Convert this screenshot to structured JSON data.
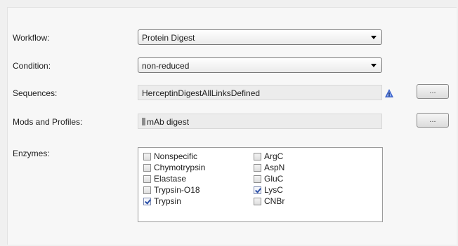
{
  "labels": {
    "workflow": "Workflow:",
    "condition": "Condition:",
    "sequences": "Sequences:",
    "mods": "Mods and Profiles:",
    "enzymes": "Enzymes:"
  },
  "workflow": {
    "selected": "Protein Digest"
  },
  "condition": {
    "selected": "non-reduced"
  },
  "sequences": {
    "value": "HerceptinDigestAllLinksDefined",
    "browse_label": "..."
  },
  "mods": {
    "value": "mAb digest",
    "browse_label": "..."
  },
  "enzymes": {
    "col1": [
      {
        "label": "Nonspecific",
        "checked": false
      },
      {
        "label": "Chymotrypsin",
        "checked": false
      },
      {
        "label": "Elastase",
        "checked": false
      },
      {
        "label": "Trypsin-O18",
        "checked": false
      },
      {
        "label": "Trypsin",
        "checked": true
      }
    ],
    "col2": [
      {
        "label": "ArgC",
        "checked": false
      },
      {
        "label": "AspN",
        "checked": false
      },
      {
        "label": "GluC",
        "checked": false
      },
      {
        "label": "LysC",
        "checked": true
      },
      {
        "label": "CNBr",
        "checked": false
      }
    ]
  },
  "colors": {
    "accent": "#2a4fa8",
    "alert_icon": "#3a5fc8"
  },
  "icons": {
    "sequences_status": "alert-triangle-icon"
  }
}
